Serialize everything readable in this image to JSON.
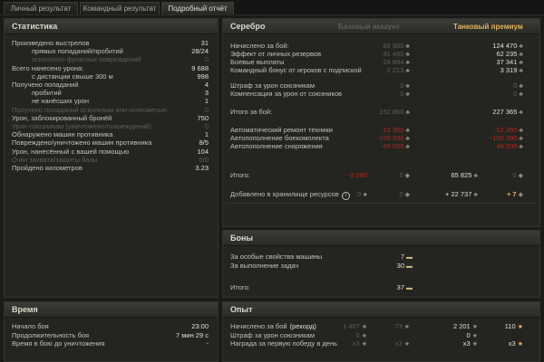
{
  "tabs": [
    {
      "label": "Личный результат"
    },
    {
      "label": "Командный результат"
    },
    {
      "label": "Подробный отчёт"
    }
  ],
  "stats": {
    "title": "Статистика",
    "rows": [
      {
        "label": "Произведено выстрелов",
        "value": "31",
        "indent": 0,
        "dim": false
      },
      {
        "label": "прямых попаданий/пробитий",
        "value": "28/24",
        "indent": 1,
        "dim": false
      },
      {
        "label": "осколочно-фугасных повреждений",
        "value": "0",
        "indent": 1,
        "dim": true
      },
      {
        "label": "Всего нанесено урона:",
        "value": "9 688",
        "indent": 0,
        "dim": false
      },
      {
        "label": "с дистанции свыше 300 м",
        "value": "998",
        "indent": 1,
        "dim": false
      },
      {
        "label": "Получено попаданий",
        "value": "4",
        "indent": 0,
        "dim": false
      },
      {
        "label": "пробитий",
        "value": "3",
        "indent": 1,
        "dim": false
      },
      {
        "label": "не нанёсших урон",
        "value": "1",
        "indent": 1,
        "dim": false
      },
      {
        "label": "Получено попаданий осколками или огнесмесью",
        "value": "0",
        "indent": 0,
        "dim": true
      },
      {
        "label": "Урон, заблокированный бронёй",
        "value": "750",
        "indent": 0,
        "dim": false
      },
      {
        "label": "Урон союзникам (уничтожено/повреждений)",
        "value": "0",
        "indent": 0,
        "dim": true
      },
      {
        "label": "Обнаружено машин противника",
        "value": "1",
        "indent": 0,
        "dim": false
      },
      {
        "label": "Повреждено/уничтожено машин противника",
        "value": "8/5",
        "indent": 0,
        "dim": false
      },
      {
        "label": "Урон, нанесённый с вашей помощью",
        "value": "104",
        "indent": 0,
        "dim": false
      },
      {
        "label": "Очки захвата/защиты базы",
        "value": "0/0",
        "indent": 0,
        "dim": true
      },
      {
        "label": "Пройдено километров",
        "value": "3.23",
        "indent": 0,
        "dim": false
      }
    ]
  },
  "time": {
    "title": "Время",
    "rows": [
      {
        "label": "Начало боя",
        "value": "23:00"
      },
      {
        "label": "Продолжительность боя",
        "value": "7 мин 29 с"
      },
      {
        "label": "Время в бою до уничтожения",
        "value": "-"
      }
    ]
  },
  "silver": {
    "title": "Серебро",
    "col_base": "Базовый аккаунт",
    "col_premium": "Танковый премиум",
    "rows": [
      {
        "label": "Начислено за бой:",
        "base": "88 980",
        "prem": "124 470",
        "base_cls": "dim",
        "prem_cls": "bright"
      },
      {
        "label": "Эффект от личных резервов",
        "base": "41 480",
        "prem": "62 235",
        "base_cls": "dim",
        "prem_cls": "bright"
      },
      {
        "label": "Боевые выплаты",
        "base": "24 894",
        "prem": "37 341",
        "base_cls": "dim",
        "prem_cls": "bright"
      },
      {
        "label": "Командный бонус от игроков с подпиской",
        "base": "2 213",
        "prem": "3 319",
        "base_cls": "dim",
        "prem_cls": "bright"
      },
      {
        "label": "Штраф за урон союзникам",
        "base": "0",
        "prem": "0",
        "base_cls": "dim",
        "prem_cls": "dim"
      },
      {
        "label": "Компенсация за урон от союзников",
        "base": "0",
        "prem": "0",
        "base_cls": "dim",
        "prem_cls": "dim"
      },
      {
        "label": "Итого за бой:",
        "base": "152 860",
        "prem": "227 365",
        "base_cls": "dim",
        "prem_cls": "bright"
      },
      {
        "label": "Автоматический ремонт техники",
        "base": "-12 350",
        "prem": "-12 350",
        "base_cls": "red",
        "prem_cls": "red"
      },
      {
        "label": "Автопополнение боекомплекта",
        "base": "-100 390",
        "prem": "-100 390",
        "base_cls": "red",
        "prem_cls": "red"
      },
      {
        "label": "Автопополнение снаряжения",
        "base": "-49 000",
        "prem": "-49 000",
        "base_cls": "red",
        "prem_cls": "red"
      }
    ],
    "total": {
      "label": "Итого:",
      "base": "-9 080",
      "base_extra": "0",
      "prem": "65 825",
      "prem_extra": "0"
    },
    "storage": {
      "label": "Добавлено в хранилище ресурсов",
      "info": "i",
      "base": "0",
      "base_extra": "0",
      "prem": "+ 22 737",
      "prem_extra": "+ 7"
    }
  },
  "bonds": {
    "title": "Боны",
    "rows": [
      {
        "label": "За особые свойства машины",
        "value": "7"
      },
      {
        "label": "За выполнение задач",
        "value": "30"
      }
    ],
    "total": {
      "label": "Итого:",
      "value": "37"
    }
  },
  "exp": {
    "title": "Опыт",
    "rows": [
      {
        "label": "Начислено за бой",
        "label_extra": "(рекорд)",
        "base": "1 467",
        "base2": "73",
        "prem": "2 201",
        "prem2": "110"
      },
      {
        "label": "Штраф за урон союзникам",
        "label_extra": "",
        "base": "0",
        "base2": "",
        "prem": "0",
        "prem2": ""
      },
      {
        "label": "Награда за первую победу в день",
        "label_extra": "",
        "base": "x3",
        "base2": "x3",
        "prem": "x3",
        "prem2": "x3"
      }
    ]
  }
}
